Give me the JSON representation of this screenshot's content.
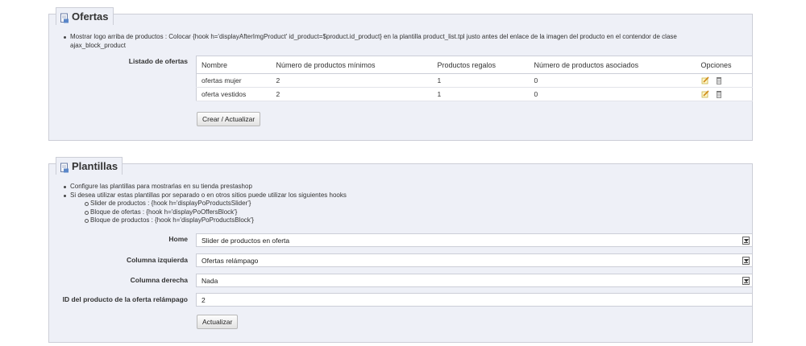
{
  "ofertas": {
    "title": "Ofertas",
    "note_line1": "Mostrar logo arriba de productos : Colocar {hook h='displayAfterImgProduct' id_product=$product.id_product} en la plantilla product_list.tpl justo antes del enlace de la imagen del producto en el contendor de clase",
    "note_line2": "ajax_block_product",
    "list_label": "Listado de ofertas",
    "table": {
      "headers": [
        "Nombre",
        "Número de productos mínimos",
        "Productos regalos",
        "Número de productos asociados",
        "Opciones"
      ],
      "rows": [
        [
          "ofertas mujer",
          "2",
          "1",
          "0"
        ],
        [
          "oferta vestidos",
          "2",
          "1",
          "0"
        ]
      ]
    },
    "submit_label": "Crear / Actualizar"
  },
  "plantillas": {
    "title": "Plantillas",
    "notes": [
      "Configure las plantillas para mostrarlas en su tienda prestashop",
      "Si desea utilizar estas plantillas por separado o en otros sitios puede utilizar los siguientes hooks"
    ],
    "hooks": [
      "Slider de productos : {hook h='displayPoProductsSlider'}",
      "Bloque de ofertas : {hook h='displayPoOffersBlock'}",
      "Bloque de productos : {hook h='displayPoProductsBlock'}"
    ],
    "fields": {
      "home_label": "Home",
      "home_value": "Slider de productos en oferta",
      "left_label": "Columna izquierda",
      "left_value": "Ofertas relámpago",
      "right_label": "Columna derecha",
      "right_value": "Nada",
      "id_label": "ID del producto de la oferta relámpago",
      "id_value": "2"
    },
    "submit_label": "Actualizar"
  },
  "icons": {
    "section": "document-icon",
    "edit": "pencil-icon",
    "delete": "trash-icon"
  }
}
